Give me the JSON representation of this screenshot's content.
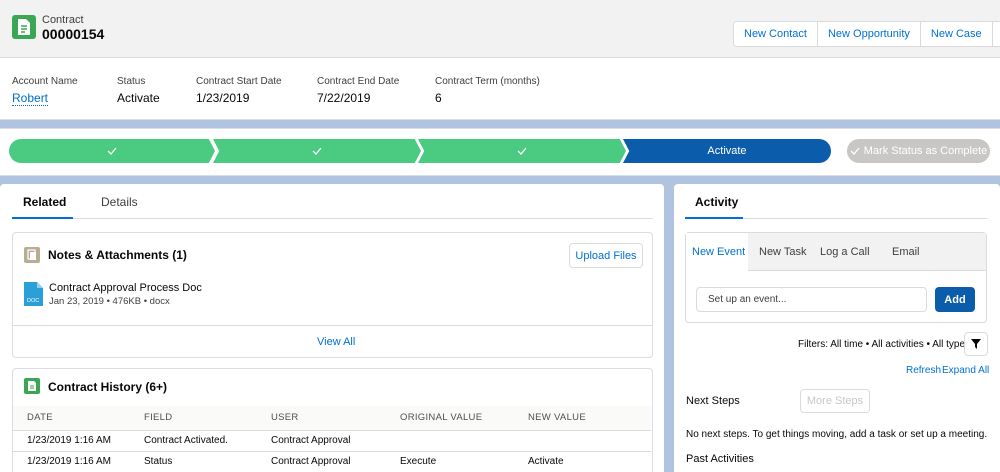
{
  "header": {
    "object_label": "Contract",
    "record_name": "00000154",
    "actions": [
      "New Contact",
      "New Opportunity",
      "New Case"
    ],
    "more_icon": "chevron-down-icon",
    "fields": [
      {
        "label": "Account Name",
        "value": "Robert"
      },
      {
        "label": "Status",
        "value": "Activate"
      },
      {
        "label": "Contract Start Date",
        "value": "1/23/2019"
      },
      {
        "label": "Contract End Date",
        "value": "7/22/2019"
      },
      {
        "label": "Contract Term (months)",
        "value": "6"
      }
    ]
  },
  "path": {
    "steps": [
      {
        "label": "",
        "state": "complete",
        "icon": "check-icon"
      },
      {
        "label": "",
        "state": "complete",
        "icon": "check-icon"
      },
      {
        "label": "",
        "state": "complete",
        "icon": "check-icon"
      },
      {
        "label": "Activate",
        "state": "current"
      }
    ],
    "mark_complete_label": "Mark Status as Complete"
  },
  "related_tabs": [
    "Related",
    "Details"
  ],
  "notes": {
    "title": "Notes & Attachments (1)",
    "upload_label": "Upload Files",
    "file": {
      "name": "Contract Approval Process Doc",
      "meta": "Jan 23, 2019 • 476KB • docx",
      "icon_text": "DOC"
    },
    "view_all": "View All"
  },
  "history": {
    "title": "Contract History (6+)",
    "columns": [
      "DATE",
      "FIELD",
      "USER",
      "ORIGINAL VALUE",
      "NEW VALUE"
    ],
    "rows": [
      [
        "1/23/2019 1:16 AM",
        "Contract Activated.",
        "Contract Approval",
        "",
        ""
      ],
      [
        "1/23/2019 1:16 AM",
        "Status",
        "Contract Approval",
        "Execute",
        "Activate"
      ]
    ]
  },
  "activity": {
    "tab_label": "Activity",
    "composer_tabs": [
      "New Event",
      "New Task",
      "Log a Call",
      "Email"
    ],
    "input_placeholder": "Set up an event...",
    "add_label": "Add",
    "filters_text": "Filters: All time • All activities • All types",
    "refresh": "Refresh",
    "expand_all": "Expand All",
    "next_steps_title": "Next Steps",
    "more_steps": "More Steps",
    "next_steps_empty": "No next steps. To get things moving, add a task or set up a meeting.",
    "past_activities_title": "Past Activities"
  },
  "colors": {
    "brand": "#0070d2",
    "path_complete": "#4bca81",
    "path_current": "#0b5cab"
  }
}
